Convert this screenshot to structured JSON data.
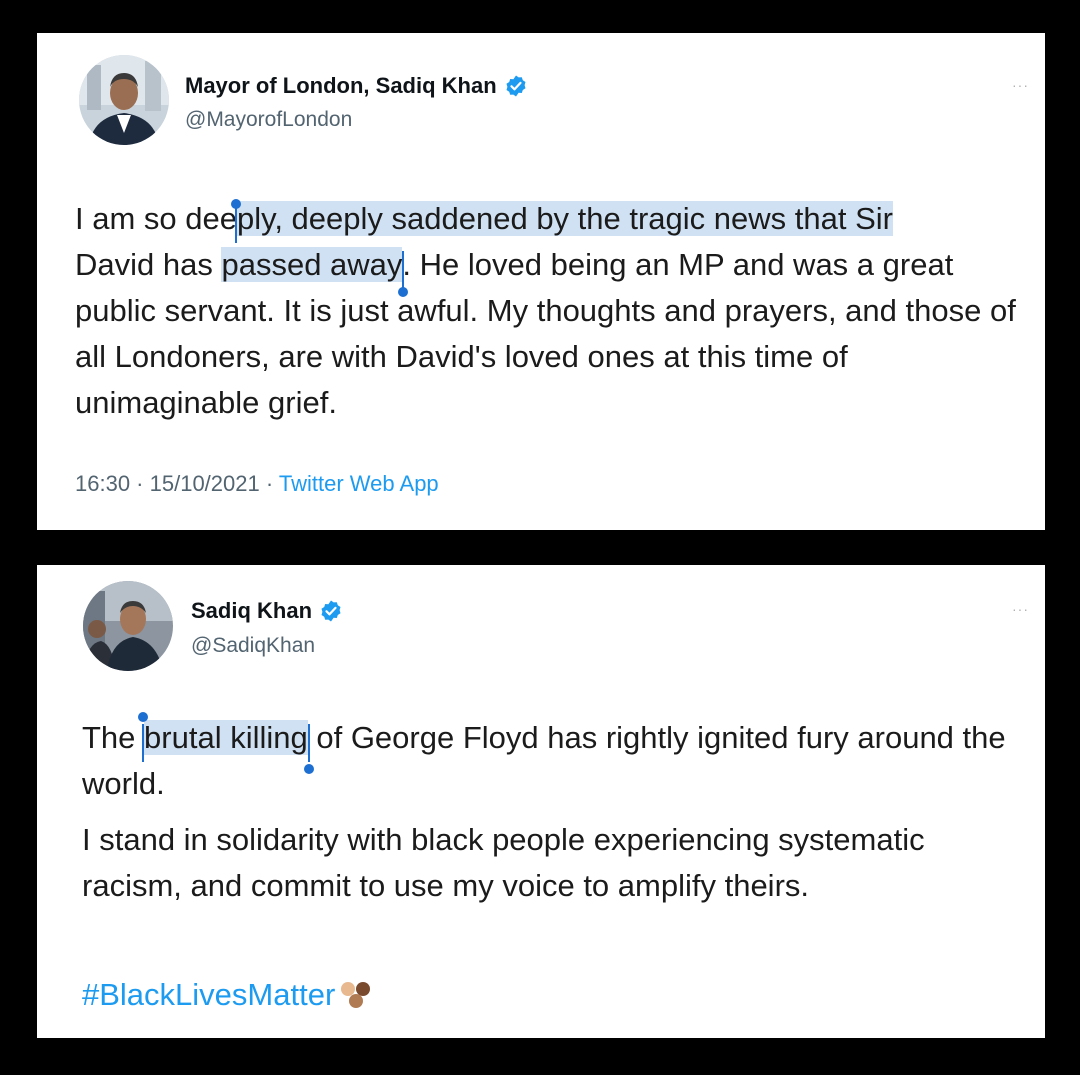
{
  "tweets": [
    {
      "name": "Mayor of London, Sadiq Khan",
      "handle": "@MayorofLondon",
      "more_label": "···",
      "text": {
        "before": "I am so de",
        "mid1": "e",
        "selected": "ply, deeply saddened by the tragic news that Sir David has passed away",
        "part_a": "ply, deeply saddened by the tragic news that Sir",
        "part_b_prefix": "David has ",
        "part_b_sel": "passed away",
        "after": ". He loved being an MP and was a great public servant. It is just awful. My thoughts and prayers, and those of all Londoners, are with David's loved ones at this time of unimaginable grief."
      },
      "time": "16:30",
      "date": "15/10/2021",
      "app": "Twitter Web App",
      "sep": " · "
    },
    {
      "name": "Sadiq Khan",
      "handle": "@SadiqKhan",
      "more_label": "···",
      "p1_before": "The ",
      "p1_selected": "brutal killing",
      "p1_after": " of George Floyd has rightly ignited fury around the world.",
      "p2": "I stand in solidarity with black people experiencing systematic racism, and commit to use my voice to amplify theirs.",
      "hashtag": "#BlackLivesMatter",
      "emoji_name": "raised-fists-skin-tones-emoji"
    }
  ],
  "colors": {
    "background": "#000000",
    "card": "#ffffff",
    "link": "#1d9bf0",
    "selection": "#cfe1f3",
    "caret": "#1d6fd1",
    "verified": "#1d9bf0"
  }
}
